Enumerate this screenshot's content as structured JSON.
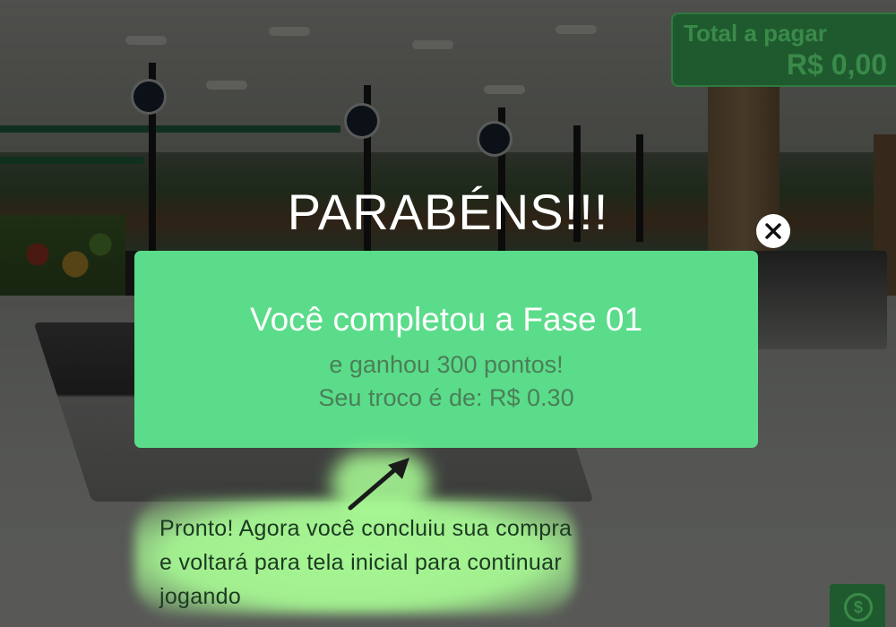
{
  "hud": {
    "total_label": "Total a pagar",
    "total_value": "R$ 0,00"
  },
  "modal": {
    "headline": "PARABÉNS!!!",
    "title": "Você completou a Fase 01",
    "points": "e ganhou 300 pontos!",
    "change": "Seu troco é de: R$ 0.30"
  },
  "hint": {
    "text": "Pronto! Agora você concluiu sua compra e voltará para tela inicial para continuar jogando"
  },
  "icons": {
    "close": "close-icon",
    "money": "money-icon",
    "arrow": "arrow-up-right-icon"
  },
  "colors": {
    "panel": "#5bdc8a",
    "hud": "#1f5a2e",
    "hint_glow": "#aaff96"
  }
}
